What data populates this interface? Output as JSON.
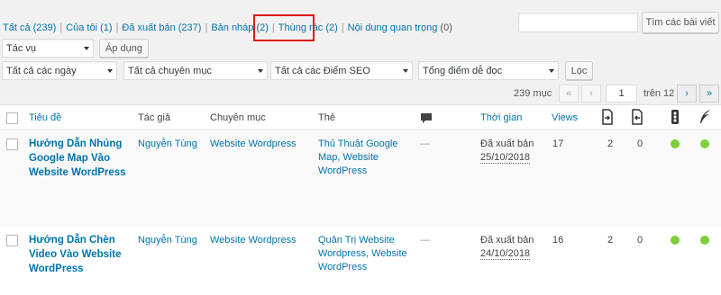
{
  "filters": {
    "all": "Tất cả (239)",
    "mine": "Của tôi (1)",
    "published": "Đã xuất bản (237)",
    "draft": "Bản nháp (2)",
    "trash": "Thùng rác (2)",
    "important": "Nội dung quan trọng",
    "important_count": "(0)"
  },
  "search": {
    "value": "",
    "button": "Tìm các bài viết"
  },
  "bulk": {
    "action": "Tác vụ",
    "apply": "Áp dụng"
  },
  "dropdowns": {
    "dates": "Tất cả các ngày",
    "categories": "Tất cả chuyên mục",
    "seo": "Tất cả các Điểm SEO",
    "readability": "Tổng điểm dễ đọc",
    "filter": "Lọc"
  },
  "pagination": {
    "count": "239 mục",
    "first": "«",
    "prev": "‹",
    "current": "1",
    "of": "trên 12",
    "next": "›",
    "last": "»"
  },
  "columns": {
    "title": "Tiêu đề",
    "author": "Tác giả",
    "category": "Chuyên mục",
    "tags": "Thẻ",
    "comments_icon": "comment-icon",
    "date": "Thời gian",
    "views": "Views",
    "links_out_icon": "outgoing-links-icon",
    "links_in_icon": "incoming-links-icon",
    "seo_icon": "seo-traffic-light-icon",
    "readability_icon": "readability-feather-icon"
  },
  "posts": [
    {
      "title_l1": "Hướng Dẫn Nhúng",
      "title_l2": "Google Map Vào",
      "title_l3": "Website WordPress",
      "author": "Nguyễn Tùng",
      "category": "Website Wordpress",
      "tags_l1": "Thủ Thuật Google",
      "tags_l2": "Map, Website",
      "tags_l3": "WordPress",
      "comments": "—",
      "status": "Đã xuất bản",
      "date": "25/10/2018",
      "views": "17",
      "links_out": "2",
      "links_in": "0",
      "seo_color": "#7ad03a",
      "read_color": "#7ad03a"
    },
    {
      "title_l1": "Hướng Dẫn Chèn",
      "title_l2": "Video Vào Website",
      "title_l3": "WordPress",
      "author": "Nguyễn Tùng",
      "category": "Website Wordpress",
      "tags_l1": "Quản Trị Website",
      "tags_l2": "Wordpress, Website",
      "tags_l3": "WordPress",
      "comments": "—",
      "status": "Đã xuất bản",
      "date": "24/10/2018",
      "views": "16",
      "links_out": "2",
      "links_in": "0",
      "seo_color": "#7ad03a",
      "read_color": "#7ad03a"
    }
  ]
}
